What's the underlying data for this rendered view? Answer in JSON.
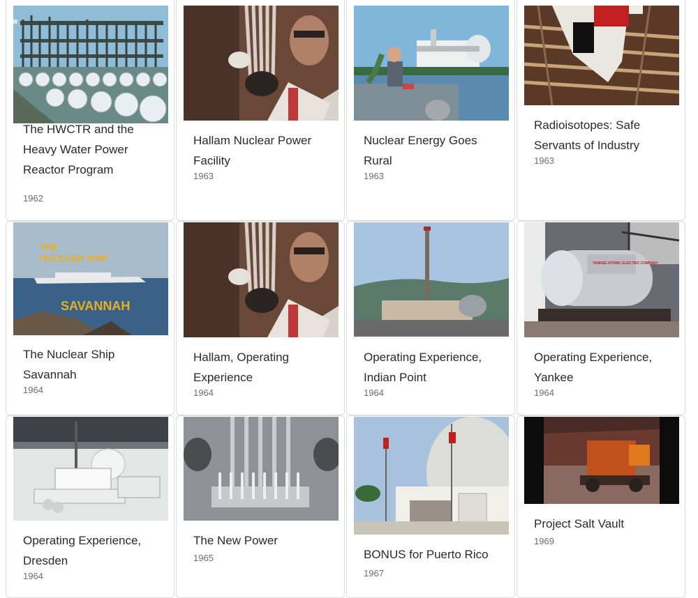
{
  "films": [
    {
      "title": "The HWCTR and the Heavy Water Power Reactor Program",
      "year": "1962",
      "thumb_icon": "hwctr-reactor-thumbnail"
    },
    {
      "title": "Hallam Nuclear Power Facility",
      "year": "1963",
      "thumb_icon": "hallam-fuel-rods-thumbnail"
    },
    {
      "title": "Nuclear Energy Goes Rural",
      "year": "1963",
      "thumb_icon": "rural-power-plant-thumbnail"
    },
    {
      "title": "Radioisotopes: Safe Servants of Industry",
      "year": "1963",
      "thumb_icon": "radioisotopes-worker-thumbnail"
    },
    {
      "title": "The Nuclear Ship Savannah",
      "year": "1964",
      "thumb_icon": "nuclear-ship-savannah-thumbnail",
      "thumb_text": [
        "THE",
        "NUCLEAR SHIP",
        "SAVANNAH"
      ]
    },
    {
      "title": "Hallam, Operating Experience",
      "year": "1964",
      "thumb_icon": "hallam-fuel-rods-thumbnail"
    },
    {
      "title": "Operating Experience, Indian Point",
      "year": "1964",
      "thumb_icon": "indian-point-plant-thumbnail"
    },
    {
      "title": "Operating Experience, Yankee",
      "year": "1964",
      "thumb_icon": "yankee-vessel-thumbnail",
      "thumb_text": [
        "YANKEE ATOMIC ELECTRIC COMPANY"
      ]
    },
    {
      "title": "Operating Experience, Dresden",
      "year": "1964",
      "thumb_icon": "dresden-plant-thumbnail"
    },
    {
      "title": "The New Power",
      "year": "1965",
      "thumb_icon": "new-power-reactor-thumbnail"
    },
    {
      "title": "BONUS for Puerto Rico",
      "year": "1967",
      "thumb_icon": "bonus-dome-thumbnail"
    },
    {
      "title": "Project Salt Vault",
      "year": "1969",
      "thumb_icon": "salt-vault-mine-thumbnail"
    }
  ],
  "colors": {
    "card_border": "#dcdcdc",
    "title_text": "#2a2a2a",
    "year_text": "#6c6c6c",
    "savannah_lettering": "#e8b020"
  }
}
